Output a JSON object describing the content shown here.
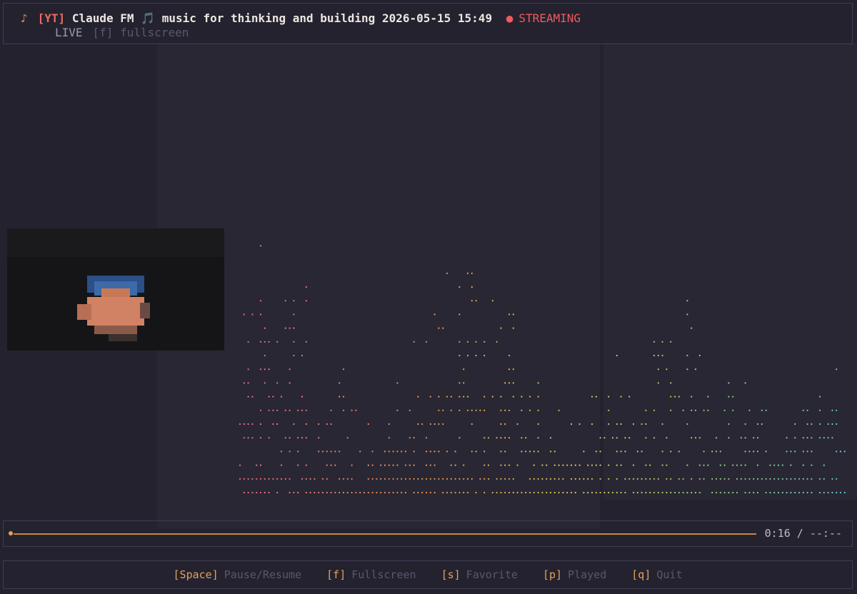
{
  "header": {
    "note_icon": "♪",
    "source_tag": "[YT]",
    "title": "Claude FM 🎵 music for thinking and building 2026-05-15 15:49",
    "status_dot": "●",
    "status": "STREAMING",
    "live": "LIVE",
    "fullscreen_hint": "[f] fullscreen"
  },
  "player": {
    "elapsed": "0:16",
    "duration": "--:--",
    "progress": 0.0
  },
  "controls": [
    {
      "key": "[Space]",
      "action": "Pause/Resume"
    },
    {
      "key": "[f]",
      "action": "Fullscreen"
    },
    {
      "key": "[s]",
      "action": "Favorite"
    },
    {
      "key": "[p]",
      "action": "Played"
    },
    {
      "key": "[q]",
      "action": "Quit"
    }
  ],
  "colors": {
    "background": "#24222f",
    "border": "#3f3d52",
    "accent": "#e3a15a",
    "streaming": "#ef5b5b"
  }
}
